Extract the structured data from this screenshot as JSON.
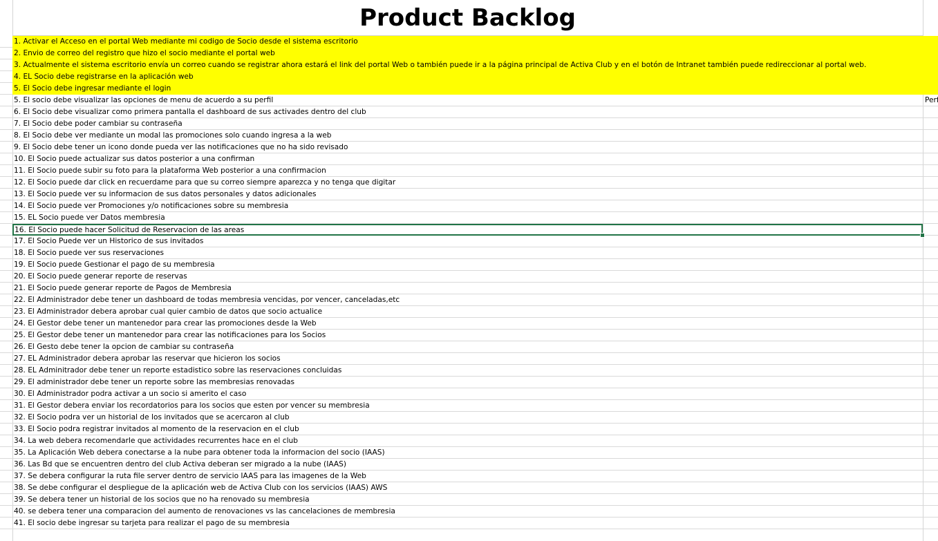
{
  "title": "Product Backlog",
  "colors": {
    "highlight": "#ffff00",
    "selection_border": "#217346",
    "grid_line": "#d9d9d9"
  },
  "selected_row_index": 16,
  "rows": [
    {
      "text": "1. Activar el Acceso en el portal Web mediante mi codigo de Socio desde el sistema escritorio",
      "highlight": true
    },
    {
      "text": "2. Envio de correo del registro que hizo el socio mediante el portal web",
      "highlight": true
    },
    {
      "text": "3. Actualmente el sistema escritorio envía un correo cuando se registrar ahora estará el link del portal Web o también puede ir a la página principal de Activa Club y en el botón de Intranet también puede redireccionar al portal web.",
      "highlight": true
    },
    {
      "text": "4. EL Socio debe registrarse en la aplicación web",
      "highlight": true
    },
    {
      "text": "5. El Socio debe ingresar mediante el login",
      "highlight": true
    },
    {
      "text": "5. El socio debe visualizar las opciones de menu de acuerdo a su perfil",
      "side": "Perf"
    },
    {
      "text": "6. El Socio debe visualizar como primera pantalla el dashboard de sus activades dentro del club"
    },
    {
      "text": "7. El Socio debe poder cambiar su contraseña"
    },
    {
      "text": "8. El Socio debe ver mediante un modal las promociones solo cuando ingresa a la web"
    },
    {
      "text": "9. El Socio debe tener un icono donde pueda ver las notificaciones que no ha sido revisado"
    },
    {
      "text": "10. El Socio puede actualizar sus datos posterior a una confirman"
    },
    {
      "text": "11. El Socio puede subir su foto para la plataforma Web posterior a una confirmacion"
    },
    {
      "text": "12. El Socio puede dar click en recuerdame para que su correo siempre aparezca y no tenga que digitar"
    },
    {
      "text": "13. El Socio puede ver su informacion de sus datos personales y datos adicionales"
    },
    {
      "text": "14. El Socio puede ver Promociones y/o notificaciones sobre su membresia"
    },
    {
      "text": "15. EL Socio puede ver Datos membresia"
    },
    {
      "text": "16. El Socio puede hacer Solicitud de Reservacion de las areas"
    },
    {
      "text": "17. El Socio Puede ver un Historico de sus invitados"
    },
    {
      "text": "18. El Socio puede ver sus reservaciones"
    },
    {
      "text": "19. El Socio puede Gestionar el pago de su membresia"
    },
    {
      "text": "20. El Socio puede generar reporte de reservas"
    },
    {
      "text": "21. El Socio puede generar reporte de Pagos de Membresia"
    },
    {
      "text": "22. El Administrador debe tener un dashboard de todas membresia vencidas, por vencer, canceladas,etc"
    },
    {
      "text": "23. El Administrador debera aprobar cual quier cambio de datos que socio actualice"
    },
    {
      "text": "24. El Gestor debe tener un mantenedor para crear las promociones desde la Web"
    },
    {
      "text": "25. El Gestor debe tener un mantenedor para crear las notificaciones para los Socios"
    },
    {
      "text": "26. El Gesto debe tener la opcion de cambiar su contraseña"
    },
    {
      "text": "27. EL Administrador debera aprobar las reservar que hicieron los socios"
    },
    {
      "text": "28. EL Adminitrador debe tener un reporte estadistico sobre las reservaciones concluidas"
    },
    {
      "text": "29. El administrador debe tener un reporte sobre las membresias renovadas"
    },
    {
      "text": "30. El Administrador podra activar a un socio si amerito el caso"
    },
    {
      "text": "31. El Gestor debera enviar los recordatorios para los socios que esten por vencer su membresia"
    },
    {
      "text": "32. El Socio podra ver un historial de los invitados que se acercaron al club"
    },
    {
      "text": "33. El Socio podra registrar invitados al momento de la reservacion en el club"
    },
    {
      "text": "34. La web debera recomendarle que actividades recurrentes hace en el club"
    },
    {
      "text": "35. La Aplicación Web debera conectarse a la nube para obtener toda la informacion del socio (IAAS)"
    },
    {
      "text": "36. Las Bd que se encuentren dentro del club Activa deberan ser migrado a la nube (IAAS)"
    },
    {
      "text": "37. Se debera configurar la ruta file server dentro de servicio IAAS para las imagenes de la Web"
    },
    {
      "text": "38. Se debe configurar el despliegue de la aplicación web de Activa Club con los servicios (IAAS) AWS"
    },
    {
      "text": "39. Se debera tener un historial de los socios que no ha renovado su membresia"
    },
    {
      "text": "40. se debera tener una comparacion del aumento de renovaciones vs las cancelaciones de membresia"
    },
    {
      "text": "41. El socio debe ingresar su tarjeta para realizar el pago de su membresia"
    }
  ]
}
